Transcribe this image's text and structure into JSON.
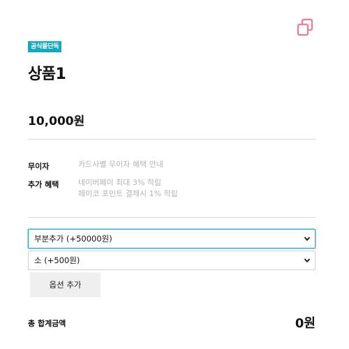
{
  "header": {
    "copy_icon": "copy-icon",
    "badge": "공식몰단독",
    "badge_color": "#17a8bf",
    "title": "상품1"
  },
  "price": "10,000원",
  "benefits": {
    "interest_free": {
      "label": "무이자",
      "value": "카드사별 무이자 혜택 안내"
    },
    "extra": {
      "label": "추가 혜택",
      "lines": [
        "네이버페이 최대 3% 적립",
        "페이코 포인트 결제시 1% 적립"
      ]
    }
  },
  "options": {
    "select1": "부분추가 (+50000원)",
    "select2": "소 (+500원)",
    "add_button": "옵션 추가"
  },
  "total": {
    "label": "총 합계금액",
    "value": "0원"
  },
  "colors": {
    "accent": "#17a8bf",
    "copy_icon": "#e0849a",
    "focus_border": "#29a7c9"
  }
}
